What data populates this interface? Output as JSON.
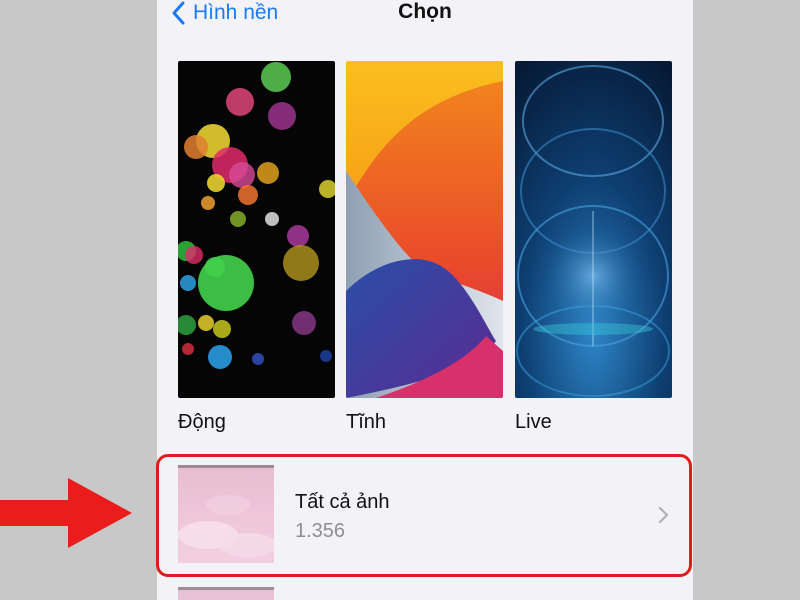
{
  "nav": {
    "back_label": "Hình nền",
    "title": "Chọn"
  },
  "categories": [
    {
      "label": "Động"
    },
    {
      "label": "Tĩnh"
    },
    {
      "label": "Live"
    }
  ],
  "album": {
    "name": "Tất cả ảnh",
    "count": "1.356"
  },
  "icons": {
    "back": "chevron-left-icon",
    "disclosure": "chevron-right-icon",
    "annotation": "red-arrow-icon"
  },
  "colors": {
    "accent": "#1a7cf5",
    "highlight": "#e01b1b",
    "background": "#f2f2f7"
  }
}
